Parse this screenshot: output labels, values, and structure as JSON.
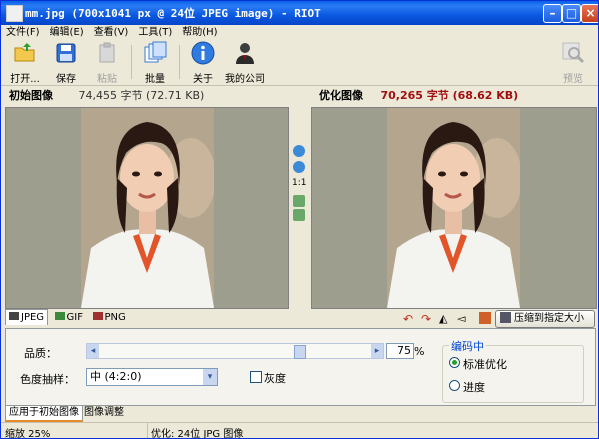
{
  "window": {
    "title": "mm.jpg (700x1041 px @ 24位 JPEG image) - RIOT"
  },
  "menu": [
    "文件(F)",
    "编辑(E)",
    "查看(V)",
    "工具(T)",
    "帮助(H)"
  ],
  "toolbar": {
    "open": "打开...",
    "save": "保存",
    "paste": "粘贴",
    "batch": "批量",
    "about": "关于",
    "company": "我的公司",
    "preview": "预览"
  },
  "original": {
    "label": "初始图像",
    "size": "74,455 字节 (72.71 KB)"
  },
  "optimized": {
    "label": "优化图像",
    "size": "70,265 字节 (68.62 KB)"
  },
  "zoom_ratio": "1:1",
  "format_tabs": [
    "JPEG",
    "GIF",
    "PNG"
  ],
  "compress_button": "压缩到指定大小",
  "options": {
    "quality_label": "品质：",
    "quality_value": "75",
    "quality_unit": "%",
    "quality_fraction": 0.75,
    "chroma_label": "色度抽样：",
    "chroma_value": "中 (4:2:0)",
    "grayscale_label": "灰度",
    "encoding_group": "编码中",
    "encoding_standard": "标准优化",
    "encoding_progressive": "进度"
  },
  "bottom_tabs": [
    "应用于初始图像",
    "图像调整"
  ],
  "status": {
    "zoom": "缩放 25%",
    "info": "优化: 24位 JPG 图像"
  }
}
